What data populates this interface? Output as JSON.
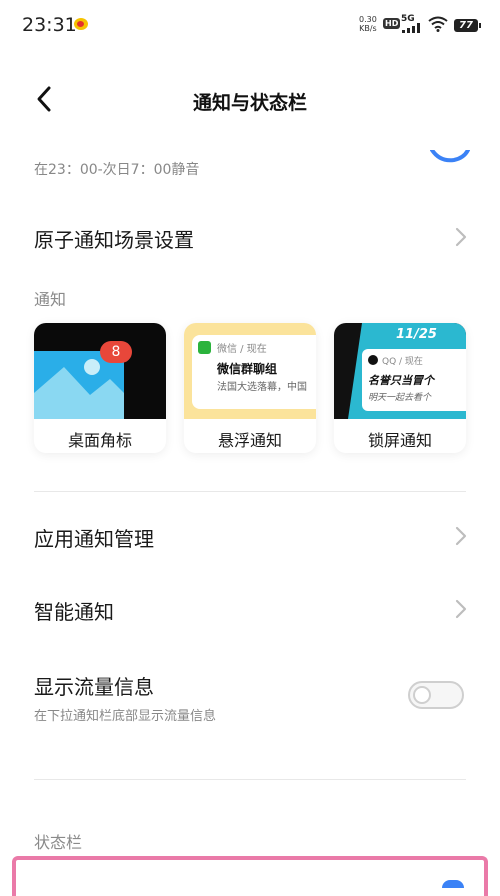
{
  "status_bar": {
    "time": "23:31",
    "net_speed_value": "0.30",
    "net_speed_unit": "KB/s",
    "hd": "HD",
    "network": "5G",
    "battery": "77"
  },
  "header": {
    "title": "通知与状态栏"
  },
  "dnd": {
    "description": "在23：00-次日7：00静音"
  },
  "atomic": {
    "label": "原子通知场景设置"
  },
  "notify_section": {
    "title": "通知",
    "cards": [
      {
        "label": "桌面角标",
        "badge": "8"
      },
      {
        "label": "悬浮通知",
        "app": "微信 / 现在",
        "heading": "微信群聊组",
        "text": "法国大选落幕，中国"
      },
      {
        "label": "锁屏通知",
        "clock": "11/25",
        "app": "QQ / 现在",
        "heading": "名誉只当冒个",
        "text": "明天一起去看个"
      }
    ]
  },
  "rows": {
    "app_notify": "应用通知管理",
    "smart_notify": "智能通知",
    "traffic": "显示流量信息",
    "traffic_desc": "在下拉通知栏底部显示流量信息"
  },
  "status_section": {
    "title": "状态栏"
  },
  "colors": {
    "accent_blue": "#3b82f6",
    "highlight_pink": "#ea7aa8"
  }
}
